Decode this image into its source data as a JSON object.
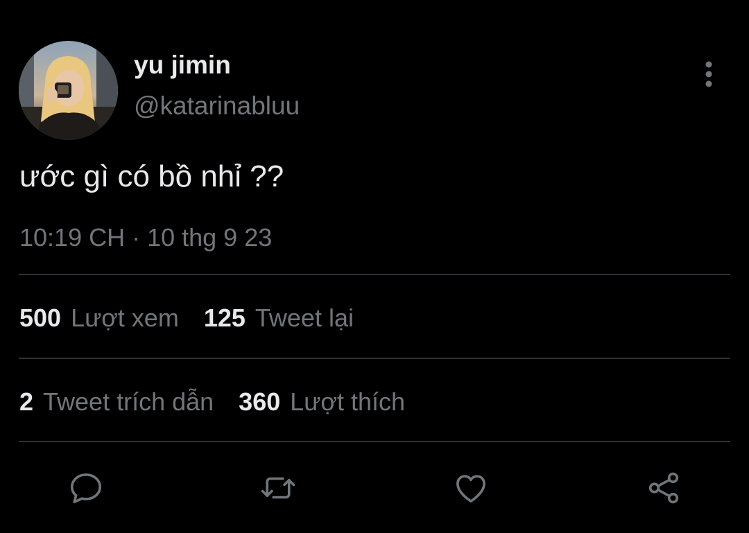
{
  "author": {
    "display_name": "yu jimin",
    "handle": "@katarinabluu",
    "avatar_icon": "profile-photo"
  },
  "tweet": {
    "text": "ước gì có bồ nhỉ ??",
    "timestamp": "10:19 CH · 10 thg 9 23"
  },
  "stats": {
    "views": {
      "count": "500",
      "label": "Lượt xem"
    },
    "retweets": {
      "count": "125",
      "label": "Tweet lại"
    },
    "quotes": {
      "count": "2",
      "label": "Tweet trích dẫn"
    },
    "likes": {
      "count": "360",
      "label": "Lượt thích"
    }
  },
  "actions": [
    "reply-icon",
    "retweet-icon",
    "like-icon",
    "share-icon"
  ],
  "colors": {
    "background": "#000000",
    "primary_text": "#e7e9ea",
    "secondary_text": "#71767b",
    "divider": "#2f3336"
  }
}
